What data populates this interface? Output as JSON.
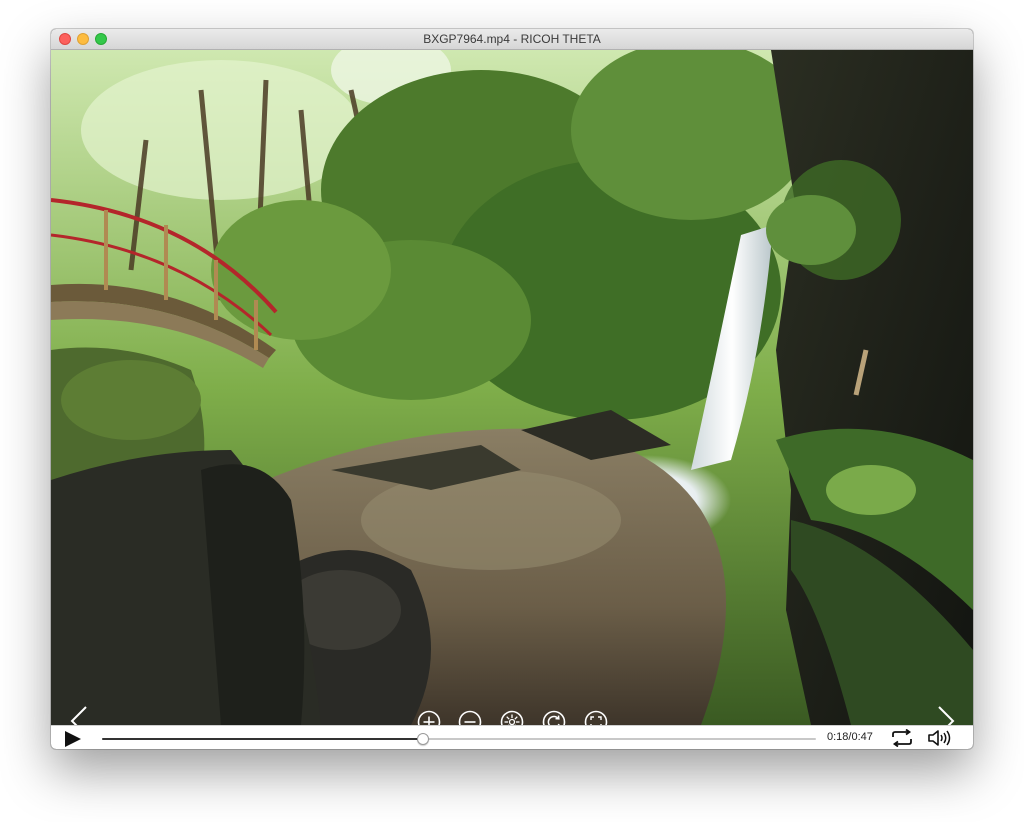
{
  "window": {
    "title": "BXGP7964.mp4 - RICOH THETA"
  },
  "player": {
    "current_time": "0:18",
    "duration": "0:47",
    "progress_percent": 45
  },
  "icons": {
    "prev": "chevron-left-icon",
    "next": "chevron-right-icon",
    "zoom_in": "zoom-in-icon",
    "zoom_out": "zoom-out-icon",
    "little_planet": "little-planet-icon",
    "rotate": "rotate-icon",
    "fullscreen": "fullscreen-icon",
    "play": "play-icon",
    "loop": "loop-icon",
    "volume": "volume-icon"
  }
}
